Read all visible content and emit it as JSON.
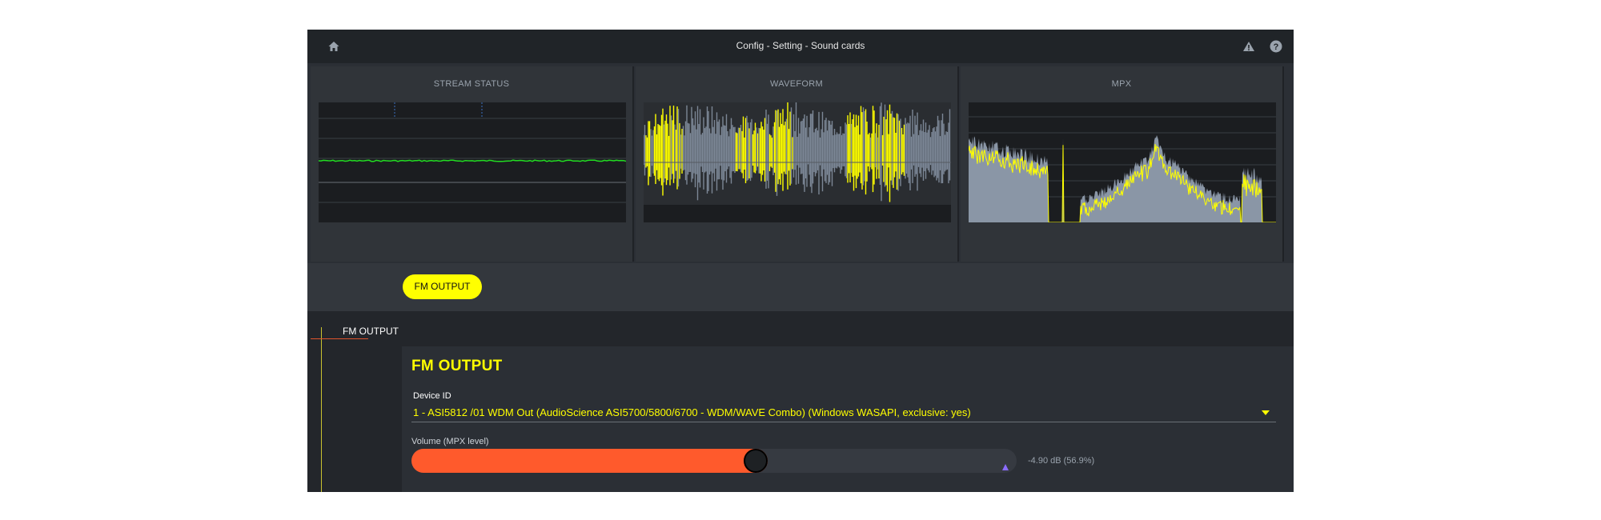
{
  "header": {
    "title": "Config - Setting - Sound cards",
    "left_icon": "home-icon",
    "right_icons": [
      "warning-icon",
      "help-icon"
    ]
  },
  "panels": [
    {
      "title": "STREAM STATUS"
    },
    {
      "title": "WAVEFORM"
    },
    {
      "title": "MPX"
    }
  ],
  "toolbar": {
    "fm_output_button": "FM OUTPUT"
  },
  "tree": {
    "item_label": "FM OUTPUT"
  },
  "fm_output": {
    "title": "FM OUTPUT",
    "device_label": "Device ID",
    "device_value": "1 - ASI5812 /01 WDM Out (AudioScience ASI5700/5800/6700 - WDM/WAVE Combo) (Windows WASAPI, exclusive: yes)",
    "volume_label": "Volume (MPX level)",
    "volume_readout": "-4.90 dB (56.9%)",
    "volume_fraction": 0.569
  },
  "colors": {
    "accent_yellow": "#ffff00",
    "slider_orange": "#ff5a2c",
    "stream_green": "#22dd22",
    "spectrum_gray": "#8a96a6"
  }
}
